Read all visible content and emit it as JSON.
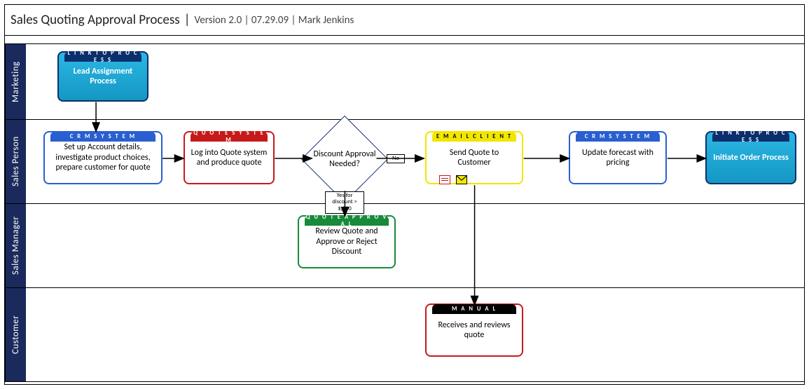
{
  "header": {
    "title": "Sales Quoting Approval Process",
    "separator": "|",
    "meta": "Version 2.0 | 07.29.09 | Mark Jenkins"
  },
  "lanes": {
    "marketing": "Marketing",
    "sales": "Sales Person",
    "manager": "Sales Manager",
    "customer": "Customer"
  },
  "labels": {
    "link_to_process": "L I N K  T O  P R O C E S S",
    "crm_system": "C R M  S Y S T E M",
    "quote_system": "Q U O T E  S Y S T E M",
    "email_client": "E M A I L  C L I E N T",
    "quote_approval": "Q U O T E  A P P R O V A L",
    "manual": "M A N U A L"
  },
  "nodes": {
    "lead_assignment": "Lead Assignment Process",
    "setup_account": "Set up Account details, investigate product choices, prepare customer for quote",
    "produce_quote": "Log into Quote system and produce quote",
    "discount_decision": "Discount Approval Needed?",
    "send_quote": "Send Quote to Customer",
    "update_forecast": "Update forecast with pricing",
    "initiate_order": "Initiate Order Process",
    "review_quote": "Review Quote and Approve or Reject Discount",
    "receives_quote": "Receives and reviews quote"
  },
  "edges": {
    "no": "No",
    "yes": "Yes for discount > $,000"
  },
  "chart_data": {
    "type": "swimlane-flowchart",
    "title": "Sales Quoting Approval Process",
    "version": "2.0",
    "date": "07.29.09",
    "author": "Mark Jenkins",
    "lanes": [
      "Marketing",
      "Sales Person",
      "Sales Manager",
      "Customer"
    ],
    "nodes": [
      {
        "id": "lead",
        "lane": "Marketing",
        "type": "link-process",
        "system": "LINK TO PROCESS",
        "label": "Lead Assignment Process"
      },
      {
        "id": "setup",
        "lane": "Sales Person",
        "type": "task",
        "system": "CRM SYSTEM",
        "label": "Set up Account details, investigate product choices, prepare customer for quote"
      },
      {
        "id": "quote",
        "lane": "Sales Person",
        "type": "task",
        "system": "QUOTE SYSTEM",
        "label": "Log into Quote system and produce quote"
      },
      {
        "id": "decide",
        "lane": "Sales Person",
        "type": "decision",
        "label": "Discount Approval Needed?"
      },
      {
        "id": "send",
        "lane": "Sales Person",
        "type": "task",
        "system": "EMAIL CLIENT",
        "label": "Send Quote to Customer"
      },
      {
        "id": "forecast",
        "lane": "Sales Person",
        "type": "task",
        "system": "CRM SYSTEM",
        "label": "Update forecast with pricing"
      },
      {
        "id": "order",
        "lane": "Sales Person",
        "type": "link-process",
        "system": "LINK TO PROCESS",
        "label": "Initiate Order Process"
      },
      {
        "id": "review",
        "lane": "Sales Manager",
        "type": "task",
        "system": "QUOTE APPROVAL",
        "label": "Review Quote and Approve or Reject Discount"
      },
      {
        "id": "receive",
        "lane": "Customer",
        "type": "task",
        "system": "MANUAL",
        "label": "Receives and reviews quote"
      }
    ],
    "edges": [
      {
        "from": "lead",
        "to": "setup"
      },
      {
        "from": "setup",
        "to": "quote"
      },
      {
        "from": "quote",
        "to": "decide"
      },
      {
        "from": "decide",
        "to": "send",
        "label": "No"
      },
      {
        "from": "decide",
        "to": "review",
        "label": "Yes for discount > $,000"
      },
      {
        "from": "send",
        "to": "forecast"
      },
      {
        "from": "forecast",
        "to": "order"
      },
      {
        "from": "send",
        "to": "receive"
      }
    ],
    "colors": {
      "lane_header": "#1b2a5c",
      "link_process_fill": "#1fa9d6",
      "link_process_border": "#0b2f6d",
      "crm": "#2a5fd1",
      "quote": "#c61a1a",
      "email": "#f2e600",
      "approval": "#188a3a",
      "manual_border": "#c61a1a",
      "manual_tab": "#000000"
    }
  }
}
